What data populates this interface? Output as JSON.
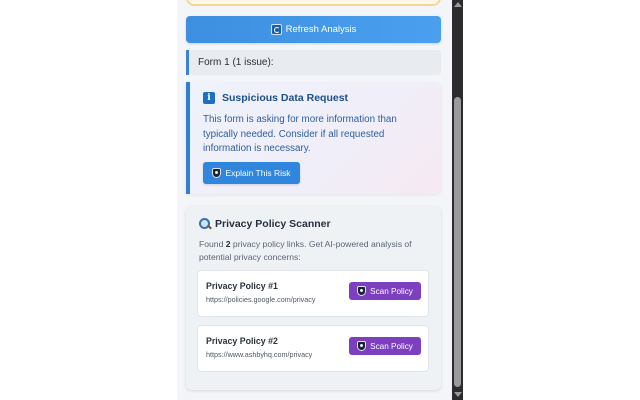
{
  "actions": {
    "refresh_label": "Refresh Analysis"
  },
  "forms": [
    {
      "heading": "Form 1 (1 issue):"
    }
  ],
  "warning": {
    "icon": "info-icon",
    "title": "Suspicious Data Request",
    "message": "This form is asking for more information than typically needed. Consider if all requested information is necessary.",
    "explain_label": "Explain This Risk"
  },
  "scanner": {
    "icon": "magnifier-icon",
    "title": "Privacy Policy Scanner",
    "desc_prefix": "Found ",
    "count": "2",
    "desc_suffix": " privacy policy links. Get AI-powered analysis of potential privacy concerns:",
    "policies": [
      {
        "name": "Privacy Policy #1",
        "url": "https://policies.google.com/privacy",
        "button": "Scan Policy"
      },
      {
        "name": "Privacy Policy #2",
        "url": "https://www.ashbyhq.com/privacy",
        "button": "Scan Policy"
      }
    ]
  },
  "colors": {
    "refresh_button": "#4196e8",
    "warning_accent": "#2f7fd6",
    "scan_button": "#7b3fc0"
  }
}
